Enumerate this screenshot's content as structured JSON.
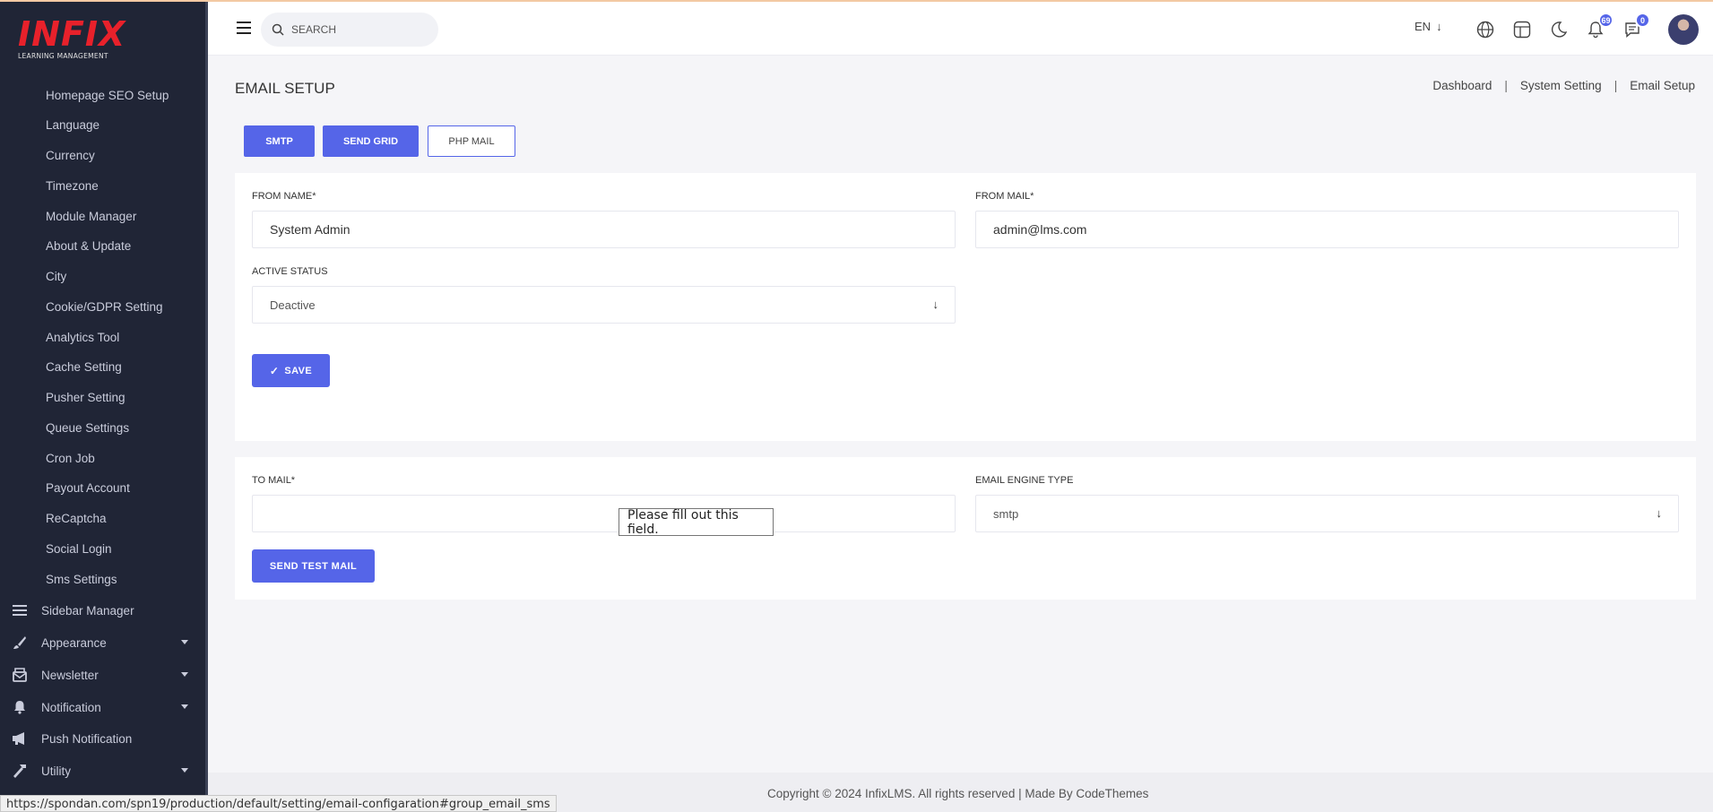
{
  "logo": {
    "main": "INFIX",
    "sub": "LEARNING MANAGEMENT"
  },
  "sidebar": {
    "sub_items": [
      "Homepage SEO Setup",
      "Language",
      "Currency",
      "Timezone",
      "Module Manager",
      "About & Update",
      "City",
      "Cookie/GDPR Setting",
      "Analytics Tool",
      "Cache Setting",
      "Pusher Setting",
      "Queue Settings",
      "Cron Job",
      "Payout Account",
      "ReCaptcha",
      "Social Login",
      "Sms Settings"
    ],
    "main_items": [
      {
        "label": "Sidebar Manager",
        "icon": "list-icon",
        "caret": false
      },
      {
        "label": "Appearance",
        "icon": "brush-icon",
        "caret": true
      },
      {
        "label": "Newsletter",
        "icon": "newsletter-icon",
        "caret": true
      },
      {
        "label": "Notification",
        "icon": "bell-icon",
        "caret": true
      },
      {
        "label": "Push Notification",
        "icon": "megaphone-icon",
        "caret": false
      },
      {
        "label": "Utility",
        "icon": "hammer-icon",
        "caret": true
      }
    ]
  },
  "header": {
    "search_placeholder": "SEARCH",
    "language": "EN",
    "notifications_count": "69",
    "messages_count": "0"
  },
  "page": {
    "title": "EMAIL SETUP",
    "breadcrumb": [
      "Dashboard",
      "System Setting",
      "Email Setup"
    ]
  },
  "tabs": [
    "SMTP",
    "SEND GRID",
    "PHP MAIL"
  ],
  "form": {
    "from_name_label": "FROM NAME*",
    "from_name_value": "System Admin",
    "from_mail_label": "FROM MAIL*",
    "from_mail_value": "admin@lms.com",
    "active_status_label": "ACTIVE STATUS",
    "active_status_value": "Deactive",
    "save_label": "SAVE"
  },
  "test_mail": {
    "to_mail_label": "TO MAIL*",
    "to_mail_value": "",
    "engine_label": "EMAIL ENGINE TYPE",
    "engine_value": "smtp",
    "send_label": "SEND TEST MAIL",
    "validation_tooltip": "Please fill out this field."
  },
  "footer": {
    "text": "Copyright © 2024 InfixLMS. All rights reserved | Made By CodeThemes"
  },
  "status_url": "https://spondan.com/spn19/production/default/setting/email-configaration#group_email_sms",
  "colors": {
    "primary": "#5565e8",
    "sidebar_bg": "#202536",
    "logo_red": "#e8212b"
  }
}
